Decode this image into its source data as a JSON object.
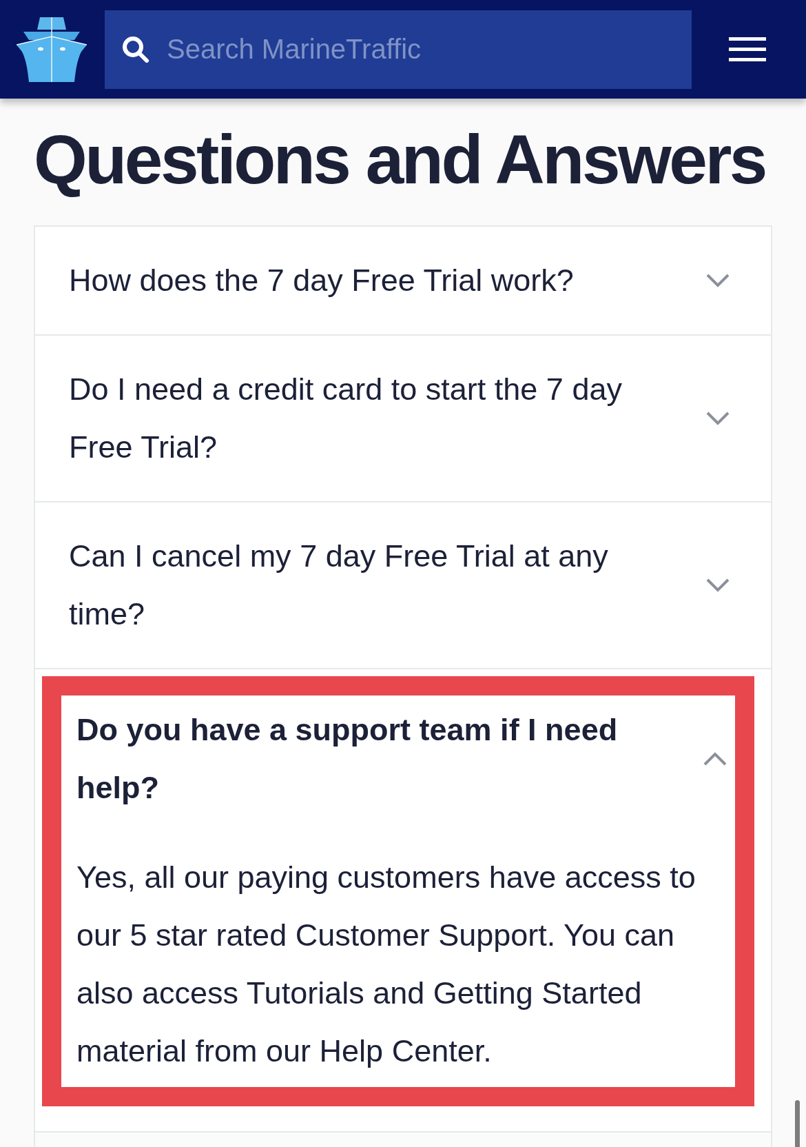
{
  "header": {
    "search": {
      "placeholder": "Search MarineTraffic"
    }
  },
  "page_title": "Questions and Answers",
  "faq": [
    {
      "question": "How does the 7 day Free Trial work?",
      "expanded": false,
      "highlighted": false
    },
    {
      "question": "Do I need a credit card to start the 7 day Free Trial?",
      "expanded": false,
      "highlighted": false
    },
    {
      "question": "Can I cancel my 7 day Free Trial at any time?",
      "expanded": false,
      "highlighted": false
    },
    {
      "question": "Do you have a support team if I need help?",
      "expanded": true,
      "highlighted": true,
      "answer": "Yes, all our paying customers have access to our 5 star rated Customer Support. You can also access Tutorials and Getting Started material from our Help Center."
    }
  ]
}
